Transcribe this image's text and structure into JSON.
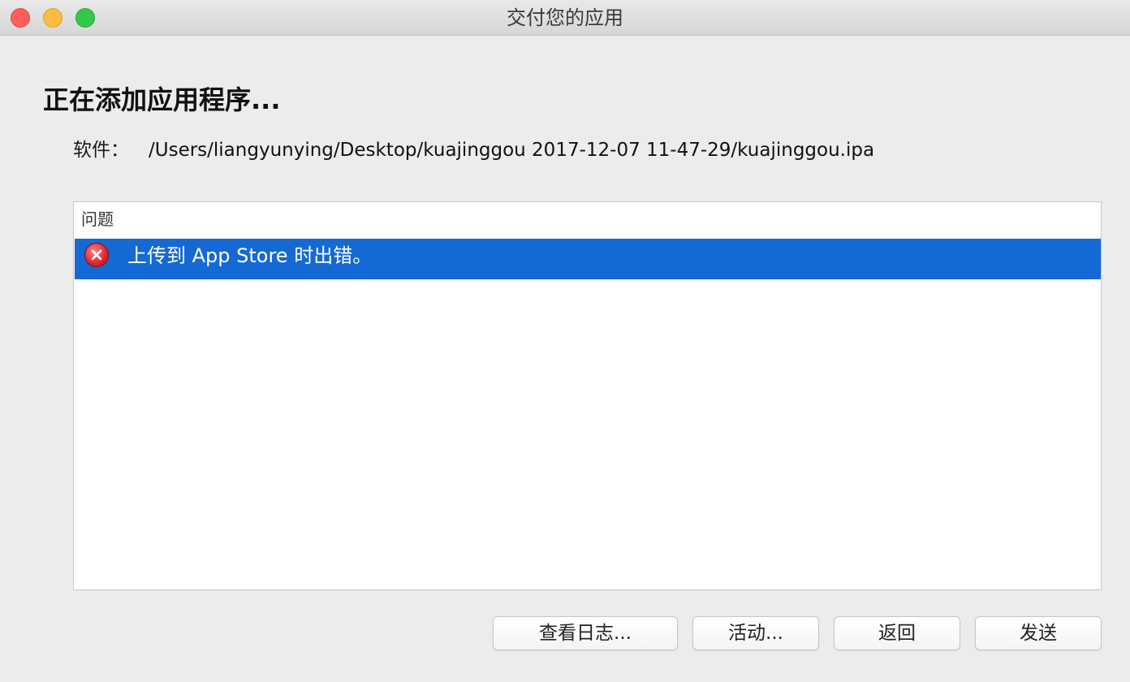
{
  "window": {
    "title": "交付您的应用"
  },
  "main": {
    "heading": "正在添加应用程序...",
    "software_label": "软件：",
    "software_path": "/Users/liangyunying/Desktop/kuajinggou 2017-12-07 11-47-29/kuajinggou.ipa"
  },
  "issues": {
    "header": "问题",
    "items": [
      {
        "icon": "error-icon",
        "text": "上传到 App Store 时出错。",
        "selected": true
      }
    ]
  },
  "buttons": {
    "view_log": "查看日志...",
    "activity": "活动...",
    "back": "返回",
    "send": "发送"
  },
  "colors": {
    "selection": "#1469d4",
    "error": "#e0232b",
    "close": "#fc605c",
    "minimize": "#fdbc40",
    "zoom": "#34c84a"
  }
}
